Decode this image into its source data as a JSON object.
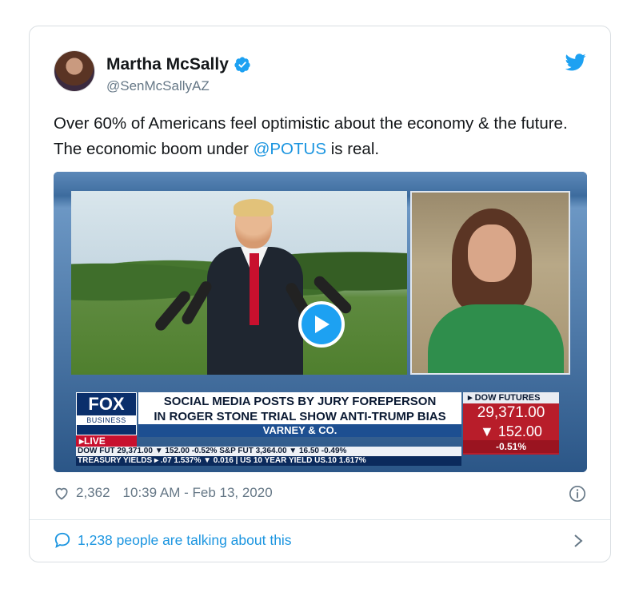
{
  "tweet": {
    "author": {
      "display_name": "Martha McSally",
      "handle": "@SenMcSallyAZ",
      "verified_icon": "verified-badge-icon"
    },
    "text_before_mention": "Over 60% of Americans feel optimistic about the economy & the future. The economic boom under ",
    "mention": "@POTUS",
    "text_after_mention": " is real.",
    "like_count": "2,362",
    "timestamp": "10:39 AM - Feb 13, 2020",
    "talking_text": "1,238 people are talking about this"
  },
  "video": {
    "logo_top": "FOX",
    "logo_bottom": "BUSINESS",
    "live_label": "LIVE",
    "headline_line1": "SOCIAL MEDIA POSTS BY JURY FOREPERSON",
    "headline_line2": "IN ROGER STONE TRIAL SHOW ANTI-TRUMP BIAS",
    "show_name": "VARNEY & CO.",
    "dow_label": "DOW FUTURES",
    "dow_value": "29,371.00",
    "dow_change": "152.00",
    "dow_pct": "-0.51%",
    "crawl_line1": "DOW FUT 29,371.00 ▼ 152.00 -0.52% S&P FUT 3,364.00 ▼ 16.50 -0.49%",
    "crawl_line2": "TREASURY YIELDS ▸ .07 1.537% ▼ 0.016 | US 10 YEAR YIELD US.10 1.617%"
  },
  "colors": {
    "link": "#1b95e0",
    "secondary_text": "#657786",
    "play_button": "#1da1f2"
  }
}
